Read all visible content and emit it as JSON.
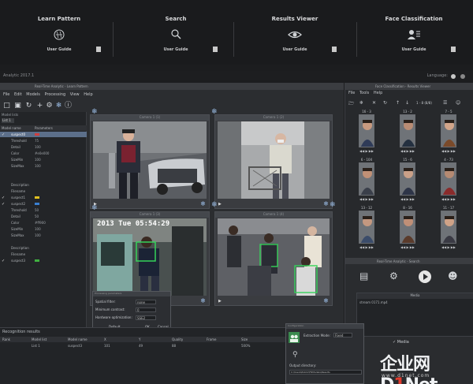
{
  "launcher": {
    "items": [
      {
        "title": "Learn Pattern",
        "guide": "User Guide"
      },
      {
        "title": "Search",
        "guide": "User Guide"
      },
      {
        "title": "Results Viewer",
        "guide": "User Guide"
      },
      {
        "title": "Face Classification",
        "guide": "User Guide"
      }
    ]
  },
  "statusline": {
    "left": "Analytic 2017.1",
    "language": "Language:"
  },
  "main": {
    "title": "Real-Time Analytic - Learn Pattern",
    "menu": [
      "File",
      "Edit",
      "Models",
      "Processing",
      "View",
      "Help"
    ],
    "left_panel": {
      "header": "Model lists",
      "tab": "List 1",
      "columns": [
        "Model name",
        "Parameters"
      ],
      "rows": [
        {
          "k": "suspect0",
          "v": "",
          "checked": true,
          "selected": true,
          "swatch": "#d04040"
        },
        {
          "k": "Threshold",
          "v": "75"
        },
        {
          "k": "Detail",
          "v": "100"
        },
        {
          "k": "Color",
          "v": "#e0e000"
        },
        {
          "k": "SizeMin",
          "v": "100"
        },
        {
          "k": "SizeMax",
          "v": "100"
        },
        {
          "k": "",
          "v": ""
        },
        {
          "k": "",
          "v": ""
        },
        {
          "k": "Description",
          "v": ""
        },
        {
          "k": "Filename",
          "v": ""
        },
        {
          "k": "suspect1",
          "v": "",
          "checked": true,
          "swatch": "#e0c020"
        },
        {
          "k": "suspect2",
          "v": "",
          "checked": true,
          "swatch": "#3a7fd0"
        },
        {
          "k": "Threshold",
          "v": "50"
        },
        {
          "k": "Detail",
          "v": "50"
        },
        {
          "k": "Color",
          "v": "#ff900"
        },
        {
          "k": "SizeMin",
          "v": "100"
        },
        {
          "k": "SizeMax",
          "v": "100"
        },
        {
          "k": "",
          "v": ""
        },
        {
          "k": "Description",
          "v": ""
        },
        {
          "k": "Filename",
          "v": ""
        },
        {
          "k": "suspect3",
          "v": "",
          "checked": true,
          "swatch": "#40b040"
        }
      ]
    },
    "videos": [
      {
        "title": "Camera 1 (1)"
      },
      {
        "title": "Camera 1 (2)"
      },
      {
        "title": "Camera 1 (3)",
        "timestamp": "2013 Tue 05:54:29"
      },
      {
        "title": "Camera 1 (4)"
      }
    ],
    "spatial_dialog": {
      "title": "Processing parameters",
      "rows": [
        {
          "label": "Spatial filter:",
          "value": "none"
        },
        {
          "label": "Minimum contrast:",
          "value": "0"
        },
        {
          "label": "Hardware optimization:",
          "value": "SSE2"
        }
      ],
      "buttons": [
        "Default",
        "OK",
        "Cancel"
      ]
    },
    "results": {
      "title": "Recognition results",
      "columns": [
        "Rank",
        "Model list",
        "Model name",
        "X",
        "Y",
        "Quality",
        "Frame",
        "Size"
      ],
      "rows": [
        [
          "",
          "List 1",
          "suspect3",
          "101",
          "49",
          "88",
          "",
          "500%"
        ]
      ]
    }
  },
  "right": {
    "title": "Face Classification - Results Viewer",
    "menu": [
      "File",
      "Tools",
      "Help"
    ],
    "sort_label": "1 - 8 (8/8)",
    "faces": [
      {
        "label": "16 - 3"
      },
      {
        "label": "13 - 2"
      },
      {
        "label": "7 - 5"
      },
      {
        "label": "6 - 104"
      },
      {
        "label": "15 - 6"
      },
      {
        "label": "4 - 73"
      },
      {
        "label": "13 - 12"
      },
      {
        "label": "8 - 16"
      },
      {
        "label": "11 - 17"
      }
    ]
  },
  "right_low": {
    "title": "Real-Time Analytic - Search",
    "table_header": "Media",
    "table_row": "stream 0171.mp4",
    "mode_label": "Media"
  },
  "config": {
    "title": "Configuration",
    "extraction_label": "Extraction Mode:",
    "extraction_value": "Fixed",
    "output_label": "Output directory:",
    "output_value": "C:\\Users\\Public\\FRModels\\Results"
  },
  "watermark": {
    "prefix": "企业网",
    "brand_a": "D",
    "brand_num": "1",
    "brand_b": "Net",
    "domain": "www.d1net.com"
  },
  "colors": {
    "accent": "#9ec0ea",
    "brand_red": "#e23b2e",
    "cfg_green": "#3a8a4e"
  }
}
